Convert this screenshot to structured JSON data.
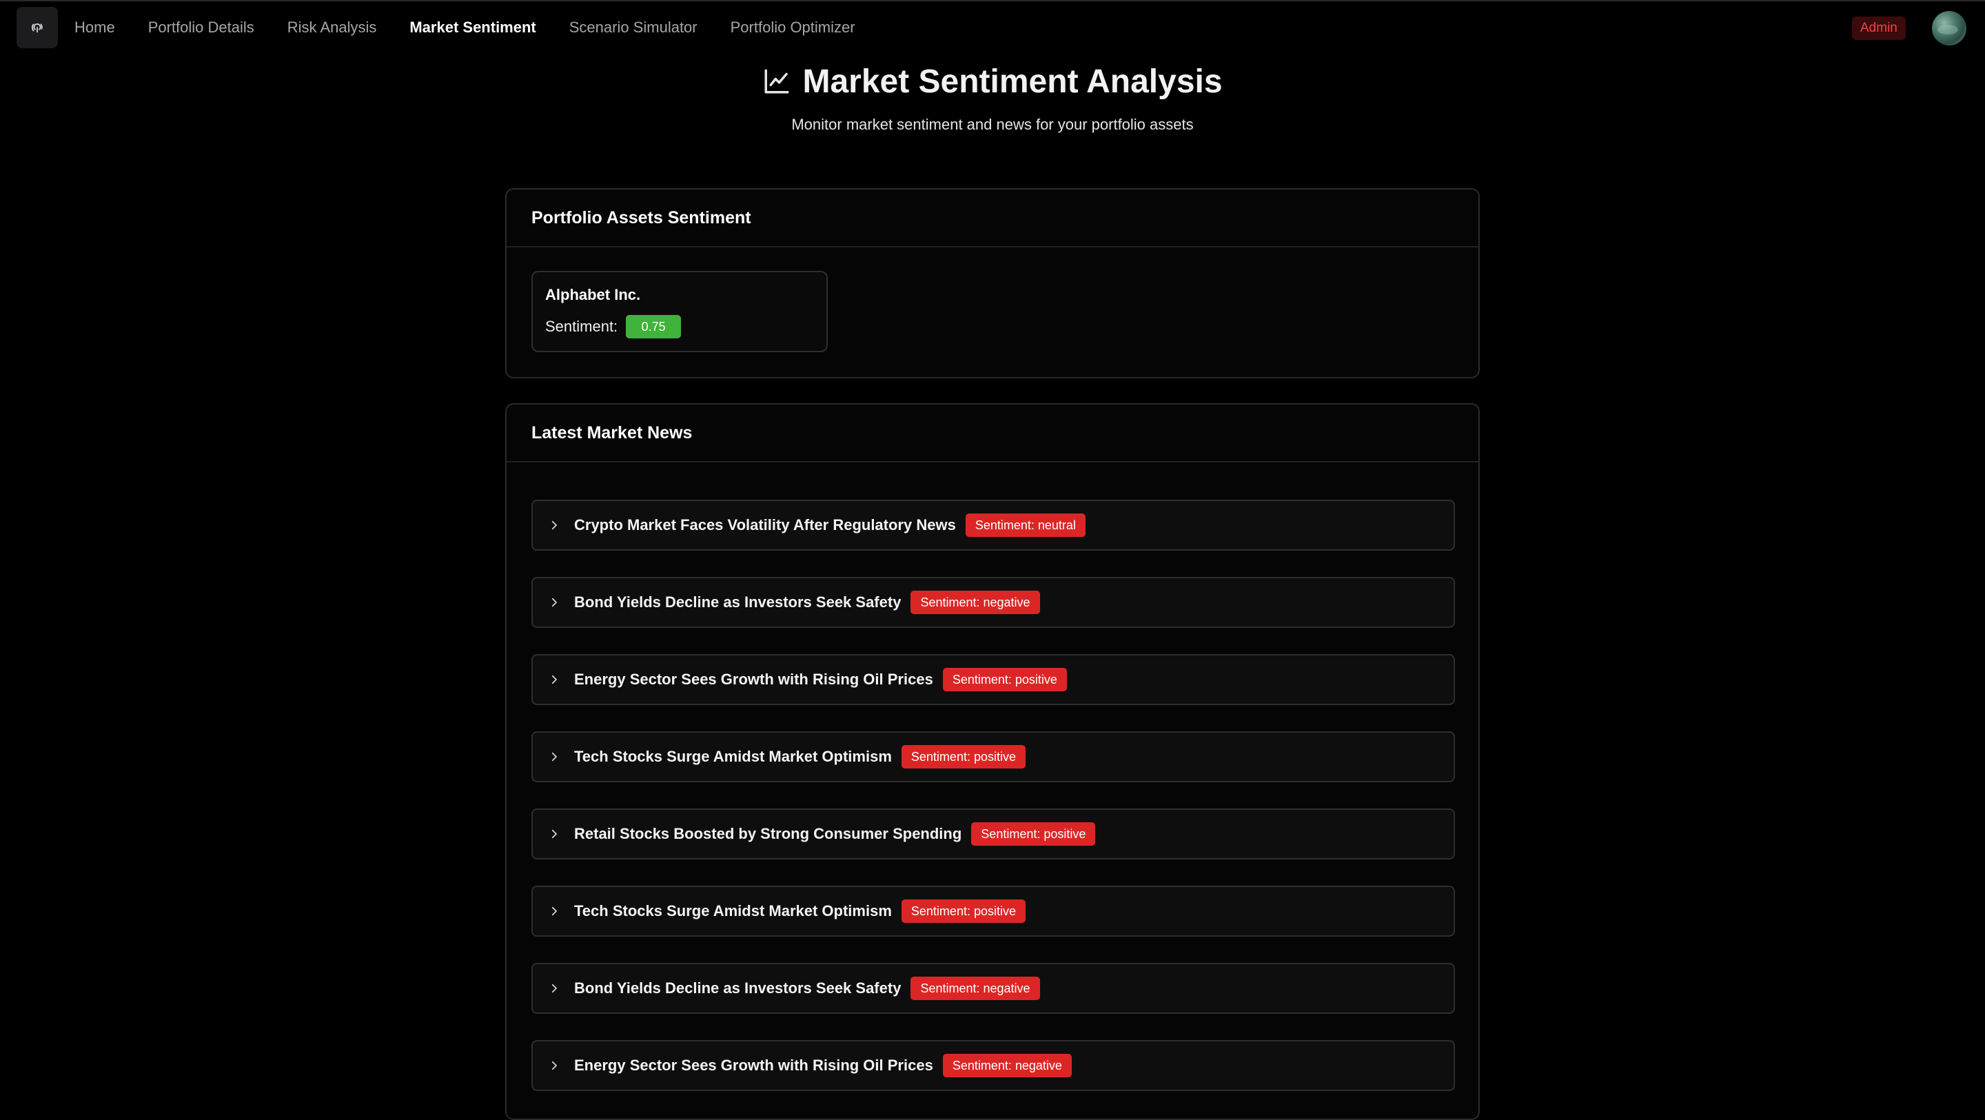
{
  "nav": {
    "items": [
      {
        "label": "Home",
        "active": false
      },
      {
        "label": "Portfolio Details",
        "active": false
      },
      {
        "label": "Risk Analysis",
        "active": false
      },
      {
        "label": "Market Sentiment",
        "active": true
      },
      {
        "label": "Scenario Simulator",
        "active": false
      },
      {
        "label": "Portfolio Optimizer",
        "active": false
      }
    ],
    "admin_label": "Admin"
  },
  "page": {
    "title": "Market Sentiment Analysis",
    "subtitle": "Monitor market sentiment and news for your portfolio assets"
  },
  "assets_card": {
    "title": "Portfolio Assets Sentiment",
    "assets": [
      {
        "name": "Alphabet Inc.",
        "sentiment_label": "Sentiment:",
        "score": "0.75"
      }
    ]
  },
  "news_card": {
    "title": "Latest Market News",
    "items": [
      {
        "title": "Crypto Market Faces Volatility After Regulatory News",
        "badge": "Sentiment: neutral"
      },
      {
        "title": "Bond Yields Decline as Investors Seek Safety",
        "badge": "Sentiment: negative"
      },
      {
        "title": "Energy Sector Sees Growth with Rising Oil Prices",
        "badge": "Sentiment: positive"
      },
      {
        "title": "Tech Stocks Surge Amidst Market Optimism",
        "badge": "Sentiment: positive"
      },
      {
        "title": "Retail Stocks Boosted by Strong Consumer Spending",
        "badge": "Sentiment: positive"
      },
      {
        "title": "Tech Stocks Surge Amidst Market Optimism",
        "badge": "Sentiment: positive"
      },
      {
        "title": "Bond Yields Decline as Investors Seek Safety",
        "badge": "Sentiment: negative"
      },
      {
        "title": "Energy Sector Sees Growth with Rising Oil Prices",
        "badge": "Sentiment: negative"
      }
    ]
  },
  "colors": {
    "background": "#000000",
    "positive_score": "#3fb33a",
    "sentiment_badge": "#dc2626",
    "admin_text": "#ef4444"
  },
  "icons": {
    "logo": "fingerprint-icon",
    "title": "line-chart-icon",
    "news_toggle": "chevron-right-icon"
  }
}
